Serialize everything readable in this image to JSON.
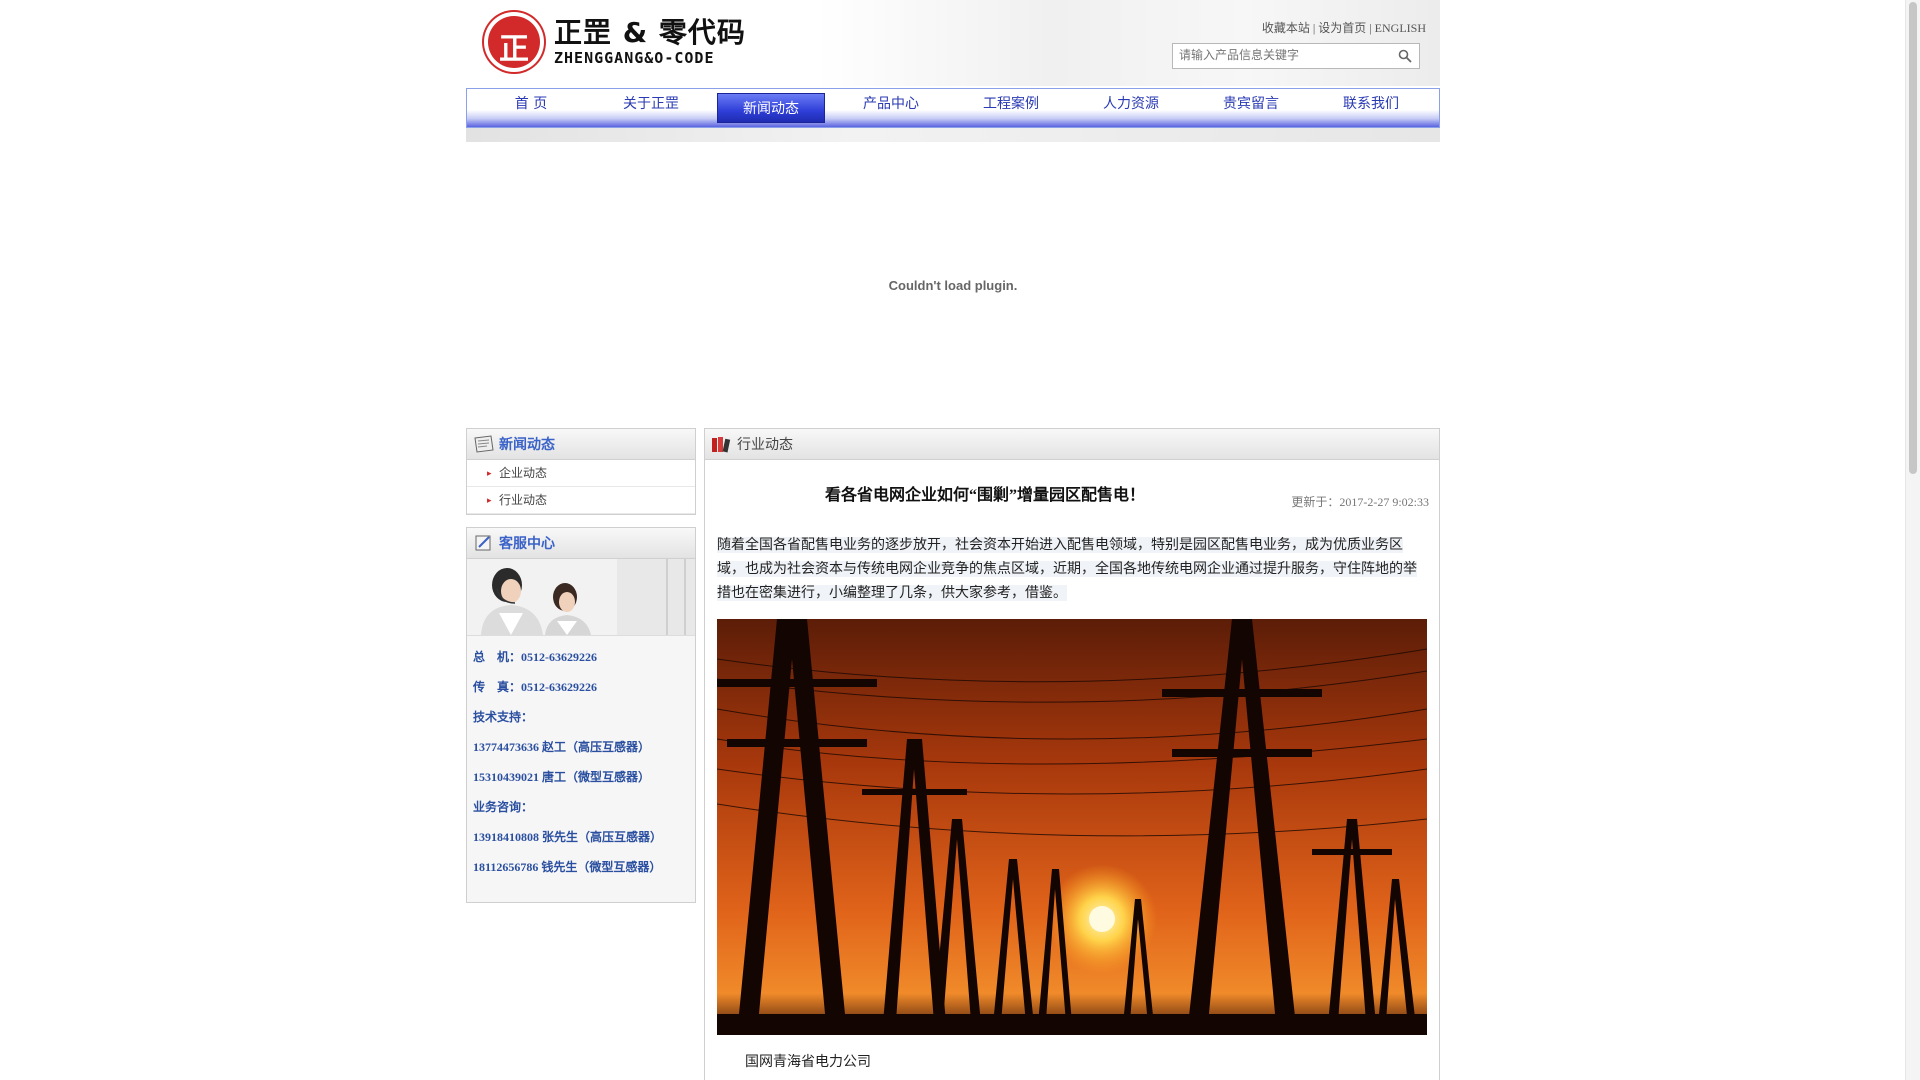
{
  "header": {
    "logo_cn": "正罡 & 零代码",
    "logo_en": "ZHENGGANG&O-CODE",
    "logo_mark": "正",
    "links": [
      "收藏本站",
      "设为首页",
      "ENGLISH"
    ],
    "search_placeholder": "请输入产品信息关键字"
  },
  "nav": {
    "items": [
      "首 页",
      "关于正罡",
      "新闻动态",
      "产品中心",
      "工程案例",
      "人力资源",
      "贵宾留言",
      "联系我们"
    ],
    "active": "新闻动态"
  },
  "plugin": {
    "message": "Couldn't load plugin."
  },
  "sidebar": {
    "news": {
      "title": "新闻动态",
      "items": [
        "企业动态",
        "行业动态"
      ]
    },
    "service": {
      "title": "客服中心",
      "contacts": [
        "总　机：0512-63629226",
        "传　真：0512-63629226",
        "技术支持：",
        "13774473636 赵工（高压互感器）",
        "15310439021 唐工（微型互感器）",
        "业务咨询：",
        "13918410808 张先生（高压互感器）",
        "18112656786 钱先生（微型互感器）"
      ]
    }
  },
  "main": {
    "section_title": "行业动态",
    "article_title": "看各省电网企业如何“围剿”增量园区配售电！",
    "updated": "更新于：2017-2-27 9:02:33",
    "paragraph": "随着全国各省配售电业务的逐步放开，社会资本开始进入配售电领域，特别是园区配售电业务，成为优质业务区域，也成为社会资本与传统电网企业竞争的焦点区域，近期，全国各地传统电网企业通过提升服务，守住阵地的举措也在密集进行，小编整理了几条，供大家参考，借鉴。",
    "caption": "国网青海省电力公司"
  },
  "colors": {
    "accent": "#2f3fd8",
    "brand_red": "#d22a2a",
    "link_blue": "#2a4fa0"
  },
  "icons": [
    "search-icon",
    "news-icon",
    "service-icon",
    "book-icon",
    "arrow-icon"
  ]
}
